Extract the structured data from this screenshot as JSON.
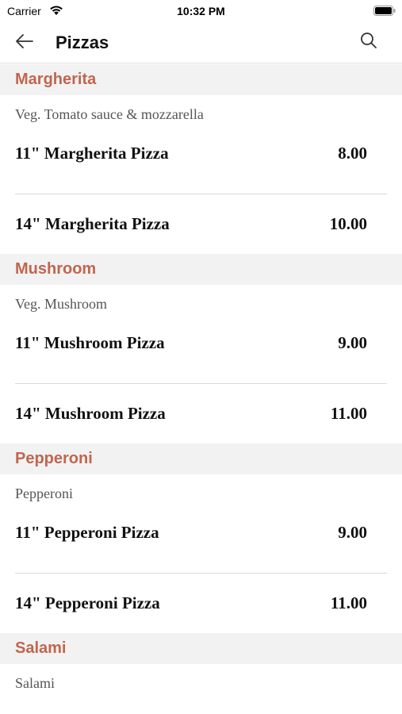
{
  "status": {
    "carrier": "Carrier",
    "time": "10:32 PM"
  },
  "nav": {
    "title": "Pizzas"
  },
  "sections": [
    {
      "name": "Margherita",
      "description": "Veg. Tomato sauce & mozzarella",
      "items": [
        {
          "name": "11\" Margherita Pizza",
          "price": "8.00"
        },
        {
          "name": "14\" Margherita Pizza",
          "price": "10.00"
        }
      ]
    },
    {
      "name": "Mushroom",
      "description": "Veg. Mushroom",
      "items": [
        {
          "name": "11\" Mushroom Pizza",
          "price": "9.00"
        },
        {
          "name": "14\" Mushroom Pizza",
          "price": "11.00"
        }
      ]
    },
    {
      "name": "Pepperoni",
      "description": "Pepperoni",
      "items": [
        {
          "name": "11\" Pepperoni Pizza",
          "price": "9.00"
        },
        {
          "name": "14\" Pepperoni Pizza",
          "price": "11.00"
        }
      ]
    },
    {
      "name": "Salami",
      "description": "Salami",
      "items": []
    }
  ],
  "colors": {
    "section_header_text": "#c0664f",
    "section_header_bg": "#f2f2f2"
  },
  "icons": {
    "back": "arrow-left-icon",
    "search": "search-icon",
    "wifi": "wifi-icon",
    "battery": "battery-icon"
  }
}
